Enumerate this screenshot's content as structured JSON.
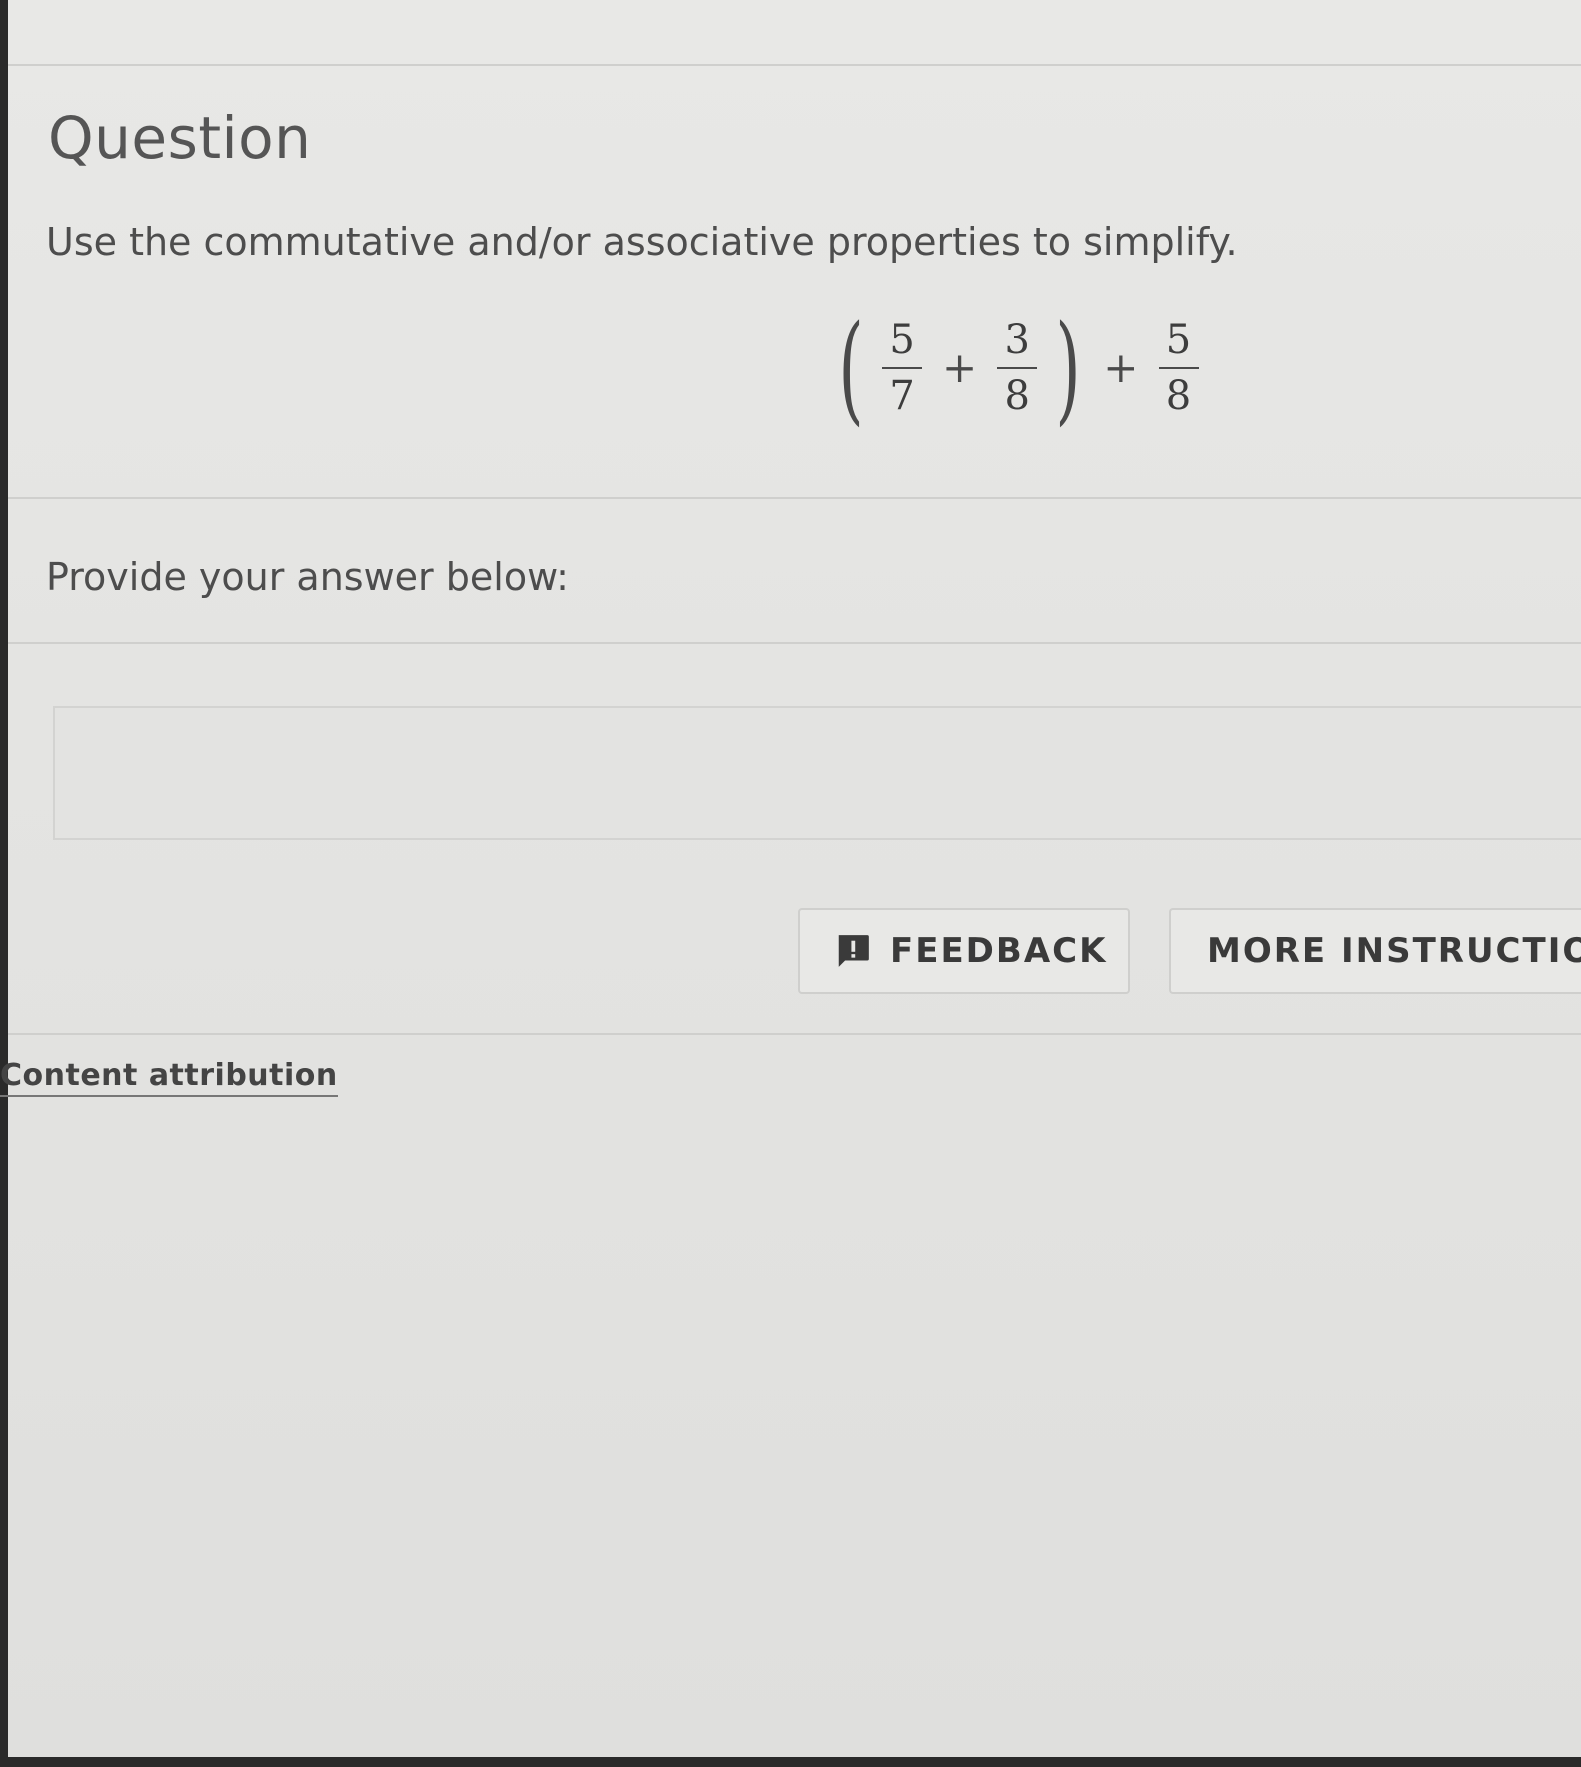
{
  "question": {
    "title": "Question",
    "prompt": "Use the commutative and/or associative properties to simplify.",
    "expression": {
      "open_paren": "(",
      "close_paren": ")",
      "frac1": {
        "num": "5",
        "den": "7"
      },
      "op1": "+",
      "frac2": {
        "num": "3",
        "den": "8"
      },
      "op2": "+",
      "frac3": {
        "num": "5",
        "den": "8"
      }
    }
  },
  "answer": {
    "label": "Provide your answer below:",
    "value": "",
    "placeholder": ""
  },
  "buttons": {
    "feedback_label": "FEEDBACK",
    "more_instructions_label": "MORE INSTRUCTIO"
  },
  "footer": {
    "attribution_link": "Content attribution"
  },
  "colors": {
    "background": "#e6e6e4",
    "text": "#4d4d4d",
    "border": "#cfcfcd"
  },
  "icons": {
    "feedback": "exclamation-speech-bubble-icon"
  }
}
